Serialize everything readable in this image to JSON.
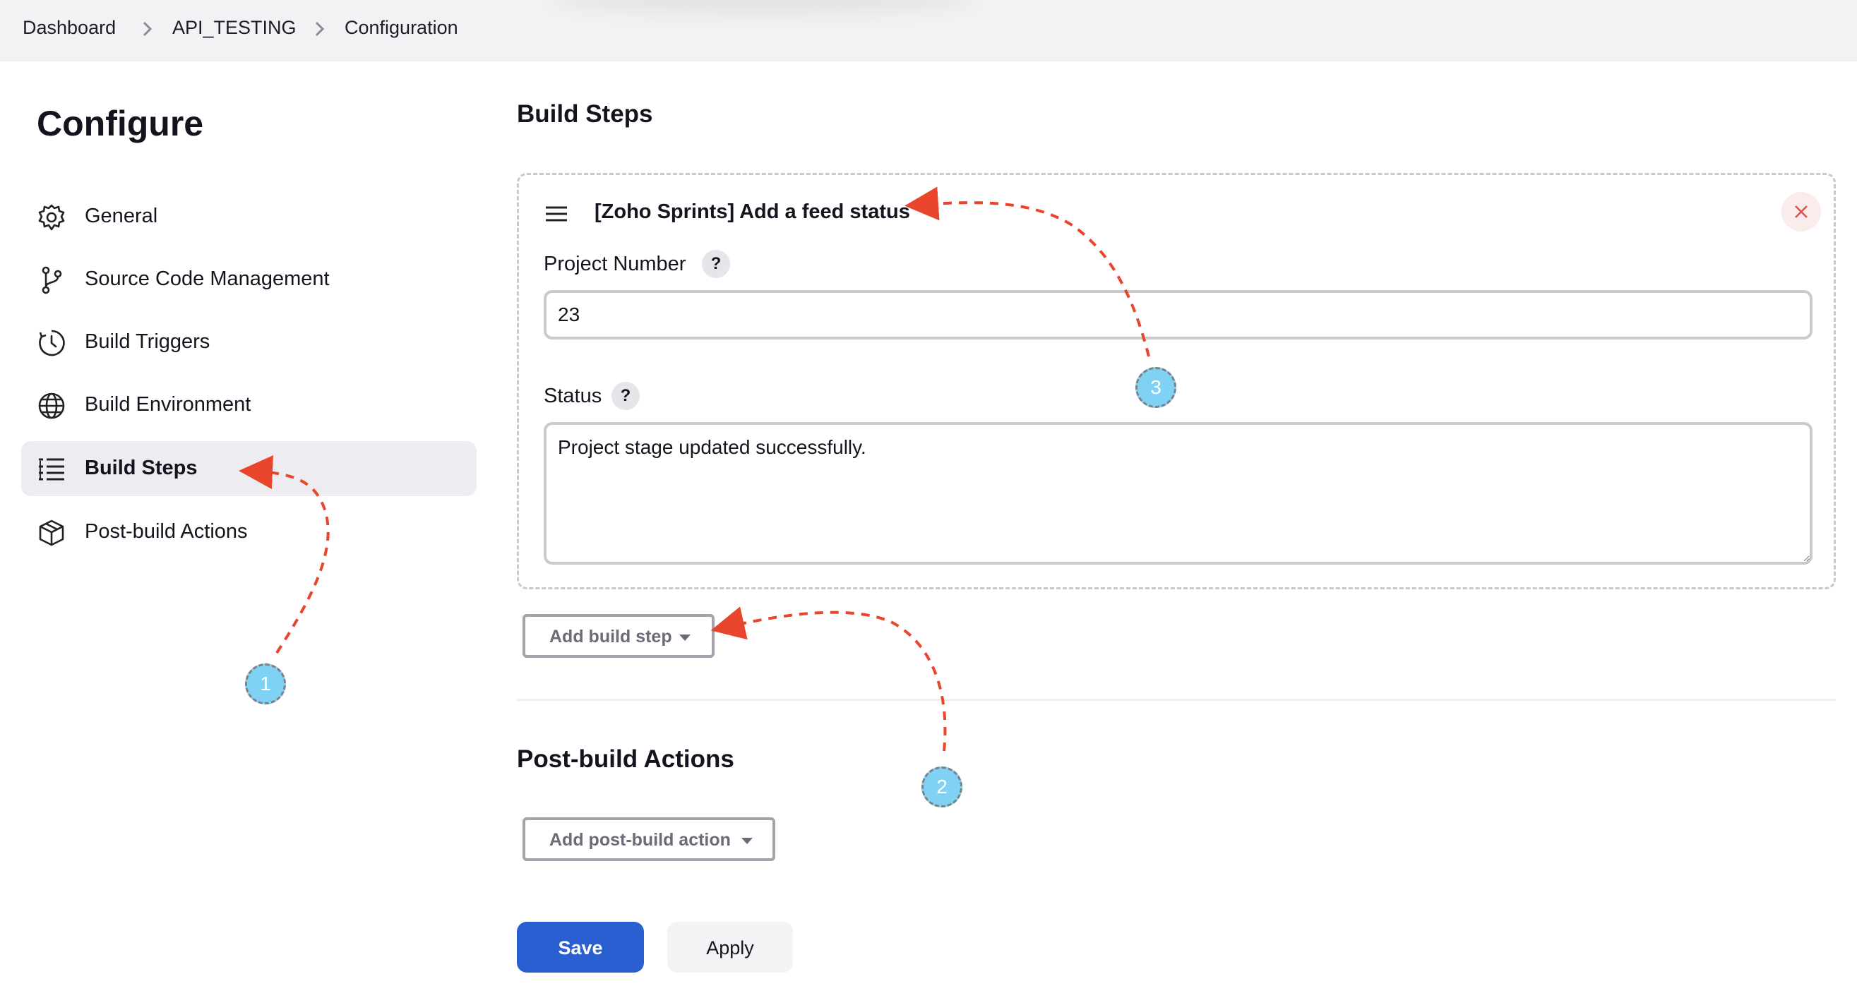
{
  "breadcrumb": {
    "items": [
      "Dashboard",
      "API_TESTING",
      "Configuration"
    ]
  },
  "sidebar": {
    "title": "Configure",
    "items": [
      {
        "label": "General",
        "icon": "gear-icon"
      },
      {
        "label": "Source Code Management",
        "icon": "branch-icon"
      },
      {
        "label": "Build Triggers",
        "icon": "clock-icon"
      },
      {
        "label": "Build Environment",
        "icon": "globe-icon"
      },
      {
        "label": "Build Steps",
        "icon": "list-icon",
        "active": true
      },
      {
        "label": "Post-build Actions",
        "icon": "package-icon"
      }
    ]
  },
  "main": {
    "build_steps": {
      "heading": "Build Steps",
      "step": {
        "title": "[Zoho Sprints] Add a feed status",
        "project_number_label": "Project Number",
        "project_number_value": "23",
        "status_label": "Status",
        "status_value": "Project stage updated successfully.",
        "help_glyph": "?"
      },
      "add_button": "Add build step"
    },
    "post_build": {
      "heading": "Post-build Actions",
      "add_button": "Add post-build action"
    },
    "actions": {
      "save": "Save",
      "apply": "Apply"
    }
  },
  "annotations": {
    "markers": [
      "1",
      "2",
      "3"
    ],
    "arrow_color": "#e8452c",
    "marker_color": "#7fd2f3"
  },
  "colors": {
    "primary": "#2a5fd1",
    "active_bg": "#ececf1",
    "topbar_bg": "#f2f2f4"
  }
}
